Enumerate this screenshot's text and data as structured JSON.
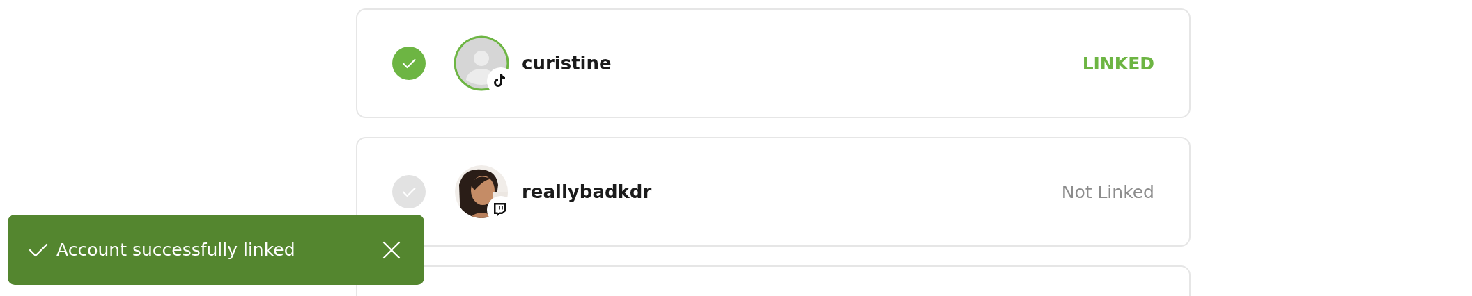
{
  "accounts": [
    {
      "name": "curistine",
      "linked": true,
      "status": "LINKED",
      "avatar": {
        "kind": "placeholder"
      },
      "platform": {
        "kind": "tiktok"
      }
    },
    {
      "name": "reallybadkdr",
      "linked": false,
      "status": "Not Linked",
      "platform": {
        "kind": "twitch"
      }
    }
  ],
  "more_below": true,
  "toast": {
    "message": "Account successfully linked"
  }
}
